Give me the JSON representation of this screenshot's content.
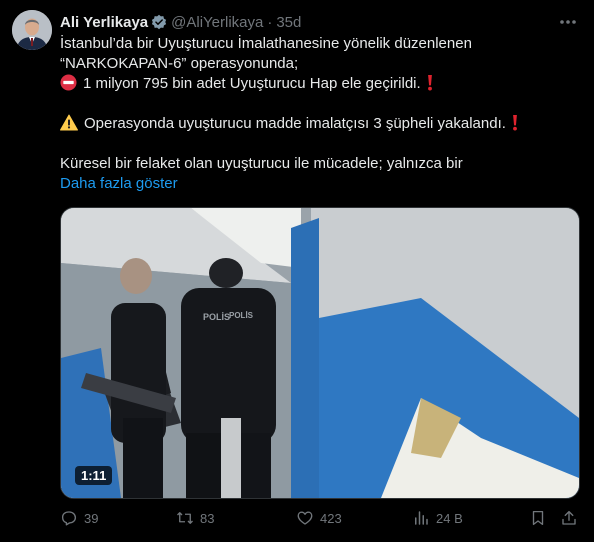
{
  "author": {
    "name": "Ali Yerlikaya",
    "handle": "@AliYerlikaya",
    "separator": "·",
    "time": "35d"
  },
  "tweet": {
    "line1": "İstanbul’da bir Uyuşturucu İmalathanesine yönelik düzenlenen",
    "line2": "“NARKOKAPAN-6” operasyonunda;",
    "line3": "1 milyon 795 bin adet Uyuşturucu Hap ele geçirildi.",
    "line5": "Operasyonda uyuşturucu madde imalatçısı 3 şüpheli yakalandı.",
    "line7": "Küresel bir felaket olan uyuşturucu ile mücadele; yalnızca bir",
    "show_more": "Daha fazla göster"
  },
  "media": {
    "duration": "1:11",
    "vest_text": "POLİS"
  },
  "actions": {
    "replies": "39",
    "reposts": "83",
    "likes": "423",
    "views": "24 B"
  },
  "icons": {
    "verified": "verified-badge-icon",
    "more": "more-dots-icon",
    "no_entry": "no-entry-emoji-icon",
    "exclamation": "red-exclamation-emoji-icon",
    "warning": "warning-emoji-icon",
    "reply": "reply-icon",
    "repost": "repost-icon",
    "like": "heart-icon",
    "views": "views-chart-icon",
    "bookmark": "bookmark-icon",
    "share": "share-icon"
  },
  "colors": {
    "background": "#000000",
    "text": "#e7e9ea",
    "secondary": "#71767b",
    "link": "#1d9bf0",
    "verified": "#829aab"
  }
}
